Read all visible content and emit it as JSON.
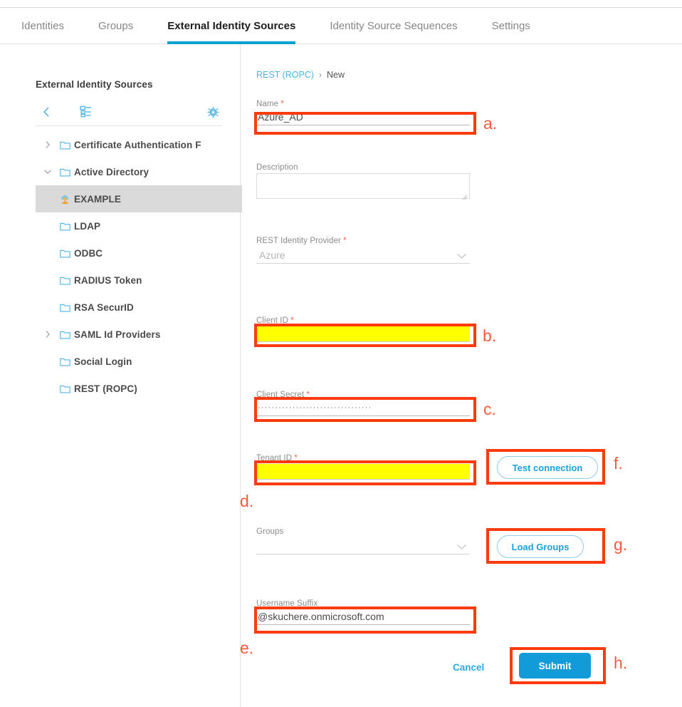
{
  "tabs": [
    {
      "label": "Identities",
      "active": false
    },
    {
      "label": "Groups",
      "active": false
    },
    {
      "label": "External Identity Sources",
      "active": true
    },
    {
      "label": "Identity Source Sequences",
      "active": false
    },
    {
      "label": "Settings",
      "active": false
    }
  ],
  "sidebar": {
    "title": "External Identity Sources",
    "toolbar": {
      "back_icon": "chevron-left-icon",
      "tree_icon": "tree-view-icon",
      "gear_icon": "gear-icon"
    },
    "items": [
      {
        "label": "Certificate Authentication F",
        "caret": "right",
        "icon": "folder-icon",
        "indent": 1,
        "selected": false
      },
      {
        "label": "Active Directory",
        "caret": "down",
        "icon": "folder-icon",
        "indent": 1,
        "selected": false
      },
      {
        "label": "EXAMPLE",
        "caret": "none",
        "icon": "ad-domain-icon",
        "indent": 2,
        "selected": true
      },
      {
        "label": "LDAP",
        "caret": "none",
        "icon": "folder-icon",
        "indent": 1,
        "selected": false
      },
      {
        "label": "ODBC",
        "caret": "none",
        "icon": "folder-icon",
        "indent": 1,
        "selected": false
      },
      {
        "label": "RADIUS Token",
        "caret": "none",
        "icon": "folder-icon",
        "indent": 1,
        "selected": false
      },
      {
        "label": "RSA SecurID",
        "caret": "none",
        "icon": "folder-icon",
        "indent": 1,
        "selected": false
      },
      {
        "label": "SAML Id Providers",
        "caret": "right",
        "icon": "folder-icon",
        "indent": 1,
        "selected": false
      },
      {
        "label": "Social Login",
        "caret": "none",
        "icon": "folder-icon",
        "indent": 1,
        "selected": false
      },
      {
        "label": "REST (ROPC)",
        "caret": "none",
        "icon": "folder-icon",
        "indent": 1,
        "selected": false
      }
    ]
  },
  "breadcrumb": {
    "root": "REST (ROPC)",
    "separator": "›",
    "current": "New"
  },
  "form": {
    "name": {
      "label": "Name",
      "required": true,
      "value": "Azure_AD",
      "placeholder": ""
    },
    "description": {
      "label": "Description",
      "required": false,
      "value": "",
      "placeholder": ""
    },
    "rest_identity_provider": {
      "label": "REST Identity Provider",
      "required": true,
      "value": "Azure",
      "caret": "chevron-down-icon"
    },
    "client_id": {
      "label": "Client ID",
      "required": true,
      "value": "",
      "placeholder": "",
      "highlight": "#ffff00"
    },
    "client_secret": {
      "label": "Client Secret",
      "required": true,
      "value": "·································",
      "placeholder": ""
    },
    "tenant_id": {
      "label": "Tenant ID",
      "required": true,
      "value": "",
      "placeholder": "",
      "highlight": "#ffff00"
    },
    "groups": {
      "label": "Groups",
      "required": false,
      "value": "",
      "caret": "chevron-down-icon"
    },
    "username_suffix": {
      "label": "Username Suffix",
      "required": false,
      "value": "@skuchere.onmicrosoft.com",
      "placeholder": ""
    },
    "test_connection_button": "Test connection",
    "load_groups_button": "Load Groups",
    "cancel_button": "Cancel",
    "submit_button": "Submit"
  },
  "annotations": [
    {
      "key": "a",
      "label": "a.",
      "target": "name-field"
    },
    {
      "key": "b",
      "label": "b.",
      "target": "client-id-field"
    },
    {
      "key": "c",
      "label": "c.",
      "target": "client-secret-field"
    },
    {
      "key": "d",
      "label": "d.",
      "target": "tenant-id-field"
    },
    {
      "key": "e",
      "label": "e.",
      "target": "username-suffix-field"
    },
    {
      "key": "f",
      "label": "f.",
      "target": "test-connection-button"
    },
    {
      "key": "g",
      "label": "g.",
      "target": "load-groups-button"
    },
    {
      "key": "h",
      "label": "h.",
      "target": "submit-button"
    }
  ],
  "colors": {
    "accent": "#00a0d1",
    "link": "#2fa8e0",
    "annotation": "#fb3b0c",
    "highlight": "#ffff00",
    "required": "#ff5f4d"
  }
}
